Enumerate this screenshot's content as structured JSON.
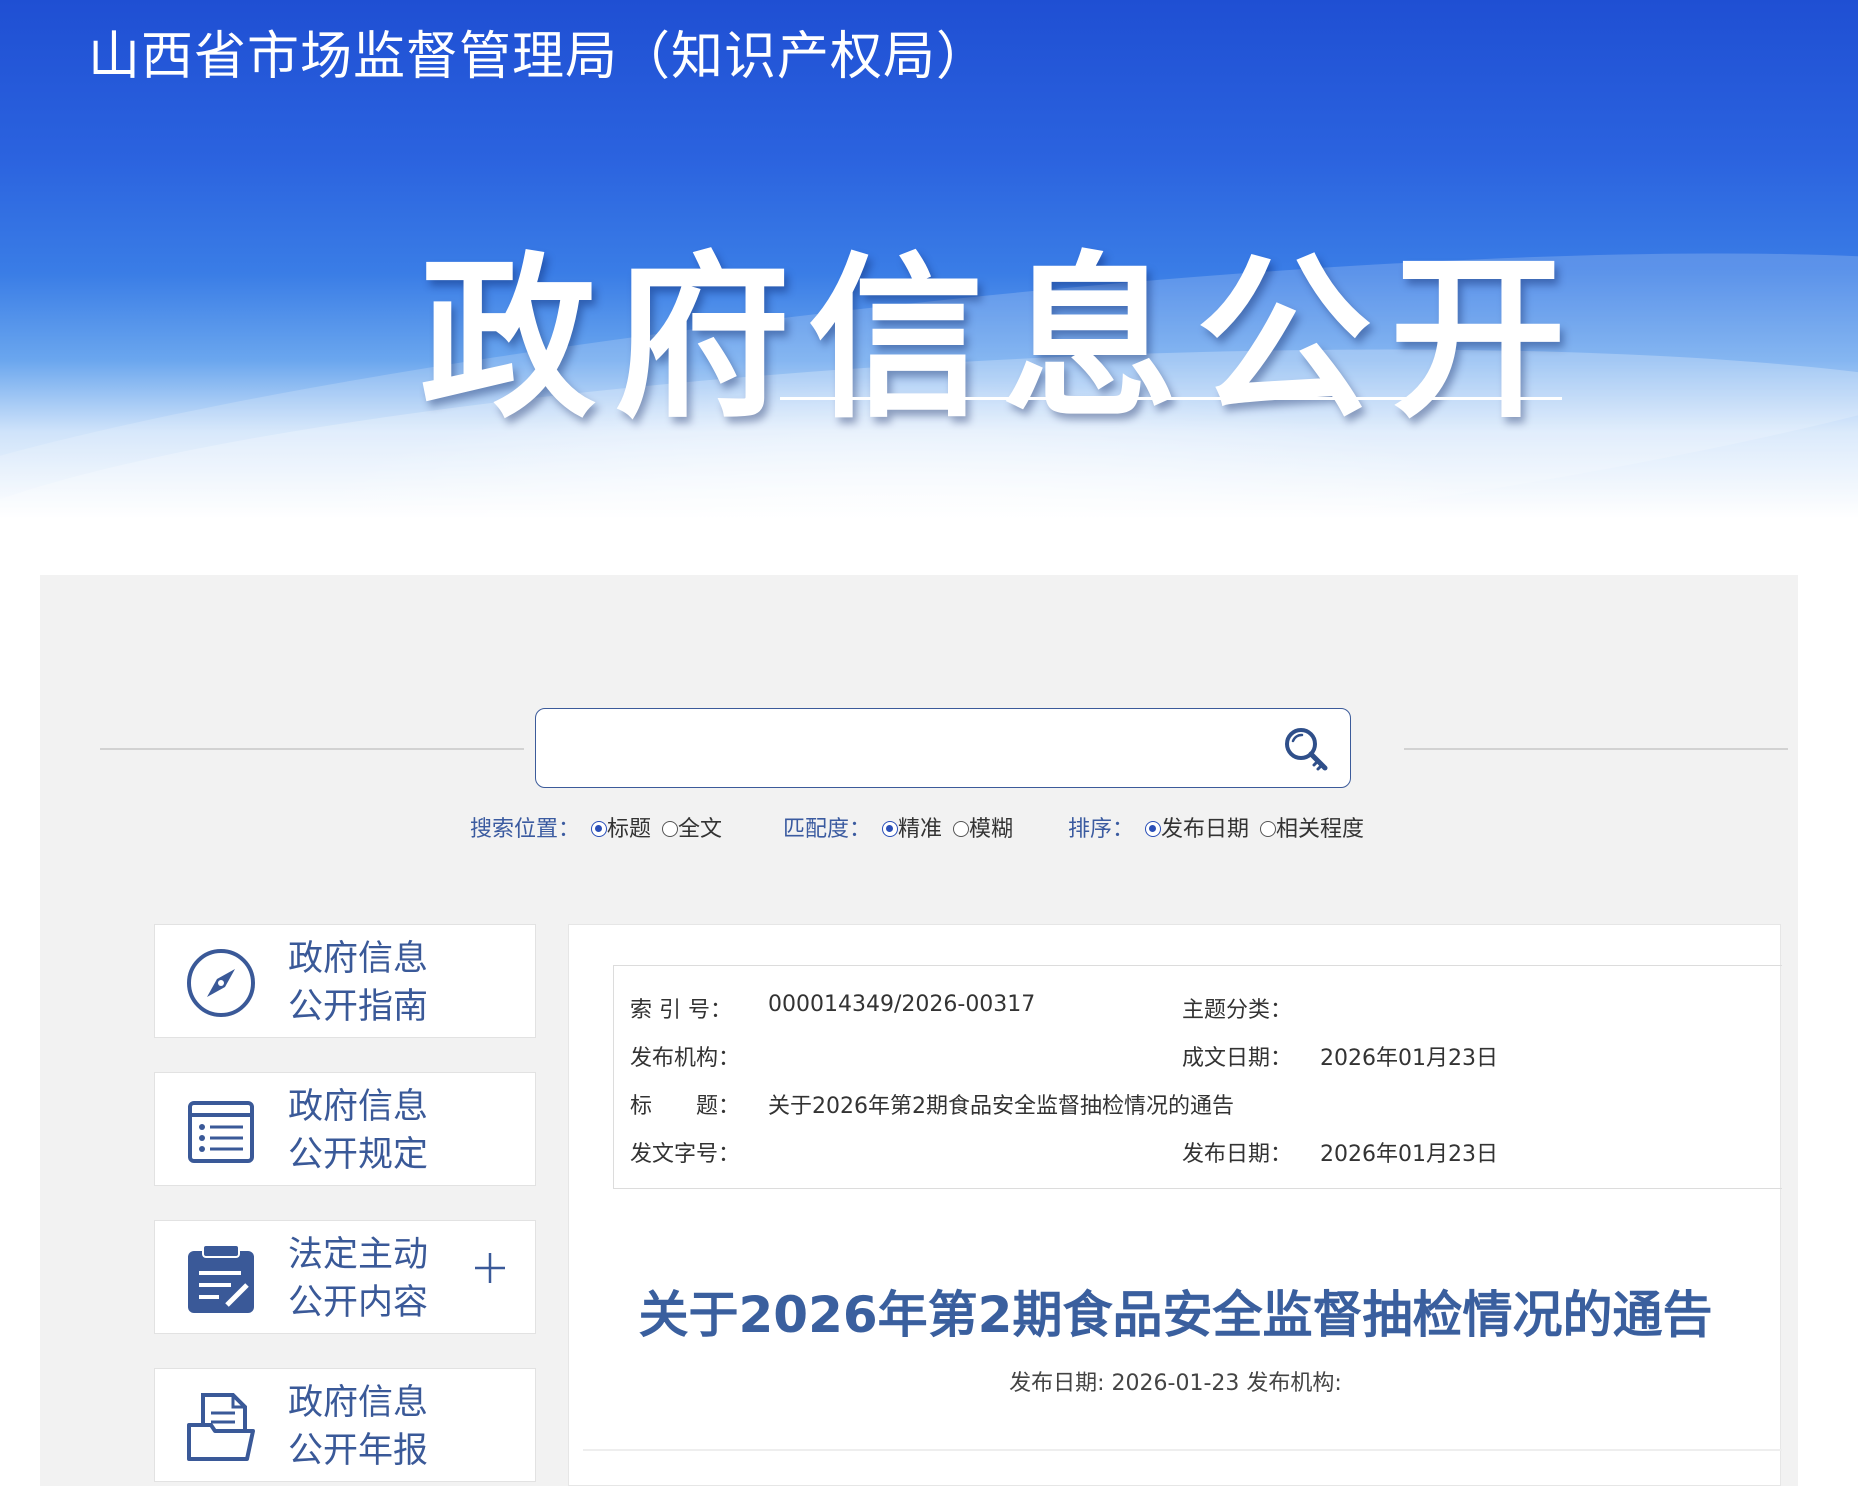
{
  "header": {
    "site_title": "山西省市场监督管理局（知识产权局）",
    "hero_title": "政府信息公开"
  },
  "search": {
    "query": "",
    "placeholder": "",
    "button_icon": "search-key-icon",
    "scope": {
      "label": "搜索位置：",
      "options": [
        {
          "label": "标题",
          "selected": true
        },
        {
          "label": "全文",
          "selected": false
        }
      ]
    },
    "match": {
      "label": "匹配度：",
      "options": [
        {
          "label": "精准",
          "selected": true
        },
        {
          "label": "模糊",
          "selected": false
        }
      ]
    },
    "sort": {
      "label": "排序：",
      "options": [
        {
          "label": "发布日期",
          "selected": true
        },
        {
          "label": "相关程度",
          "selected": false
        }
      ]
    }
  },
  "nav": {
    "items": [
      {
        "line1": "政府信息",
        "line2": "公开指南",
        "icon": "compass-icon",
        "expandable": false
      },
      {
        "line1": "政府信息",
        "line2": "公开规定",
        "icon": "document-list-icon",
        "expandable": false
      },
      {
        "line1": "法定主动",
        "line2": "公开内容",
        "icon": "clipboard-edit-icon",
        "expandable": true
      },
      {
        "line1": "政府信息",
        "line2": "公开年报",
        "icon": "folder-report-icon",
        "expandable": false
      }
    ]
  },
  "document": {
    "meta": {
      "index_no_label": "索 引 号：",
      "index_no": "000014349/2026-00317",
      "topic_label": "主题分类：",
      "topic": "",
      "publisher_label": "发布机构：",
      "publisher": "",
      "created_label": "成文日期：",
      "created": "2026年01月23日",
      "title_label": "标　　题：",
      "title": "关于2026年第2期食品安全监督抽检情况的通告",
      "doc_no_label": "发文字号：",
      "doc_no": "",
      "published_label": "发布日期：",
      "published": "2026年01月23日"
    },
    "heading": "关于2026年第2期食品安全监督抽检情况的通告",
    "subline": "发布日期: 2026-01-23 发布机构:"
  },
  "colors": {
    "accent_blue": "#3a5998",
    "title_blue": "#3a5f9e",
    "panel_gray": "#f2f2f2",
    "header_blue": "#1f4fd3"
  }
}
